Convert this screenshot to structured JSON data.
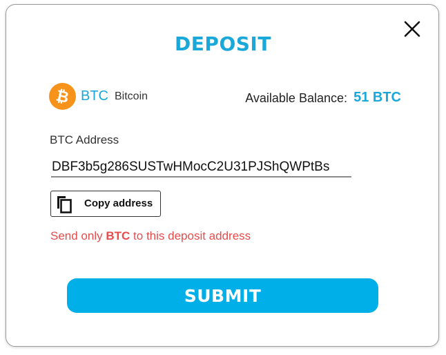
{
  "modal": {
    "title": "DEPOSIT",
    "close_icon": "close-icon"
  },
  "coin": {
    "icon": "bitcoin-icon",
    "symbol": "BTC",
    "name": "Bitcoin"
  },
  "balance": {
    "label": "Available Balance:",
    "value": "51 BTC"
  },
  "address": {
    "label": "BTC Address",
    "value": "DBF3b5g286SUSTwHMocC2U31PJShQWPtBs"
  },
  "copy": {
    "icon": "copy-icon",
    "label": "Copy address"
  },
  "warning": {
    "prefix": "Send only",
    "coin": "BTC",
    "suffix": "to this deposit address"
  },
  "submit": {
    "label": "SUBMIT"
  },
  "colors": {
    "accent": "#1aa7d9",
    "button": "#00aee8",
    "warning": "#e94b4b",
    "bitcoin": "#f7931a"
  }
}
